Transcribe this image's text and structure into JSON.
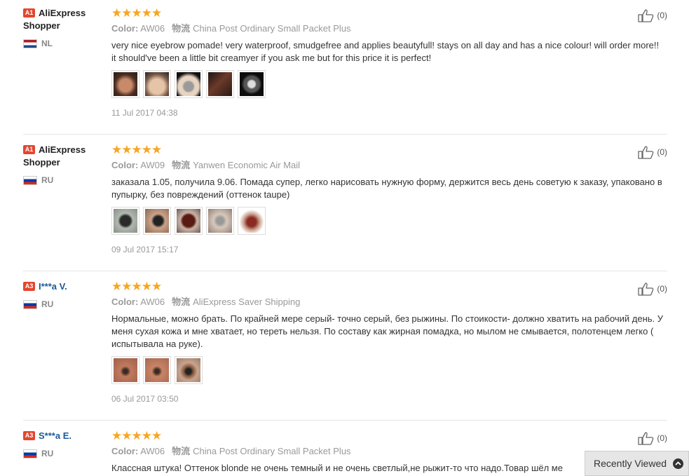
{
  "reviews": [
    {
      "badge": "A1",
      "user": "AliExpress Shopper",
      "country": "NL",
      "stars": "★★★★★",
      "color_label": "Color:",
      "color": "AW06",
      "shipping_label": "物流",
      "shipping": "China Post Ordinary Small Packet Plus",
      "text": "very nice eyebrow pomade! very waterproof, smudgefree and applies beautyfull! stays on all day and has a nice colour! will order more!! it should've been a little bit creamyer if you ask me but for this price it is perfect!",
      "date": "11 Jul 2017 04:38",
      "helpful": "(0)"
    },
    {
      "badge": "A1",
      "user": "AliExpress Shopper",
      "country": "RU",
      "stars": "★★★★★",
      "color_label": "Color:",
      "color": "AW09",
      "shipping_label": "物流",
      "shipping": "Yanwen Economic Air Mail",
      "text": "заказала 1.05, получила 9.06. Помада супер, легко нарисовать нужную форму, держится весь день советую к заказу, упаковано в пупырку, без повреждений (оттенок taupe)",
      "date": "09 Jul 2017 15:17",
      "helpful": "(0)"
    },
    {
      "badge": "A3",
      "user": "I***a V.",
      "country": "RU",
      "stars": "★★★★★",
      "color_label": "Color:",
      "color": "AW06",
      "shipping_label": "物流",
      "shipping": "AliExpress Saver Shipping",
      "text": "Нормальные, можно брать. По крайней мере серый- точно серый, без рыжины. По стоикости- должно хватить на рабочий день. У меня сухая кожа и мне хватает, но тереть нельзя. По составу как жирная помадка, но мылом не смывается, полотенцем легко ( испытывала на руке).",
      "date": "06 Jul 2017 03:50",
      "helpful": "(0)"
    },
    {
      "badge": "A3",
      "user": "S***a E.",
      "country": "RU",
      "stars": "★★★★★",
      "color_label": "Color:",
      "color": "AW06",
      "shipping_label": "物流",
      "shipping": "China Post Ordinary Small Packet Plus",
      "text": "Классная штука! Оттенок blonde не очень темный и не очень светлый,не рыжит-то что надо.Товар шёл ме",
      "helpful": "(0)"
    }
  ],
  "recently_viewed": "Recently Viewed",
  "colors": {
    "star": "#f5a623",
    "badge": "#e4462e",
    "link": "#1a5a99"
  },
  "icons": {
    "helpful": "thumbs-up-icon",
    "recent": "chevron-up-icon"
  }
}
